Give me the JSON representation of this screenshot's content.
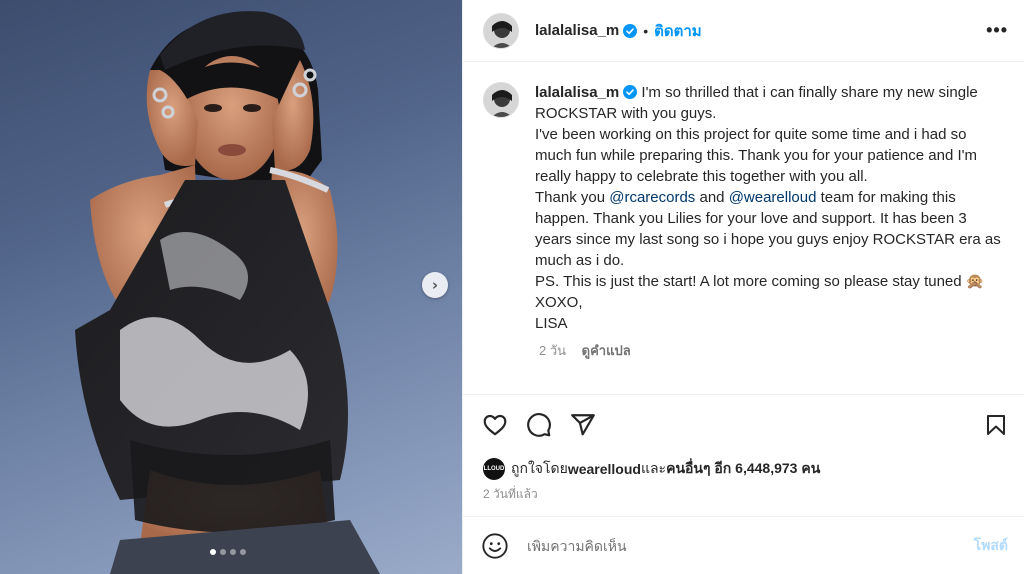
{
  "post": {
    "author": "lalalalisa_m",
    "follow_label": "ติดตาม",
    "header_separator": "•",
    "more_label": "•••",
    "verified_icon": "verified-badge-icon",
    "accent_color": "#0095f6"
  },
  "caption": {
    "username": "lalalalisa_m",
    "line1": " I'm so thrilled that i can finally share my new single ROCKSTAR with you guys.",
    "line2": "I've been working on this project for quite some time and i had so much fun while preparing this. Thank you for your patience and I'm really happy to celebrate this together with you all.",
    "thank_you_prefix": "Thank you ",
    "mention1": "@rcarecords",
    "and_word": " and ",
    "mention2": "@wearelloud",
    "line3_rest": " team for making this happen. Thank you Lilies for your love and support. It has been 3 years since my last song so i hope you guys enjoy ROCKSTAR era as much as i do.",
    "ps": "PS. This is just the start! A lot more coming so please stay tuned",
    "emoji": "🙊",
    "sign1": "XOXO,",
    "sign2": "LISA",
    "time_ago": "2 วัน",
    "translate_label": "ดูคำแปล"
  },
  "likes": {
    "avatar_text": "LLOUD",
    "prefix": "ถูกใจโดย ",
    "liked_by": "wearelloud",
    "middle": " และ",
    "others": "คนอื่นๆ อีก 6,448,973 คน"
  },
  "timestamp": "2 วันที่แล้ว",
  "comment": {
    "placeholder": "เพิ่มความคิดเห็น",
    "post_label": "โพสต์"
  },
  "carousel": {
    "total_slides": 4,
    "current_slide": 1
  },
  "icons": [
    "heart-icon",
    "comment-icon",
    "share-icon",
    "bookmark-icon",
    "emoji-icon",
    "chevron-right-icon"
  ]
}
